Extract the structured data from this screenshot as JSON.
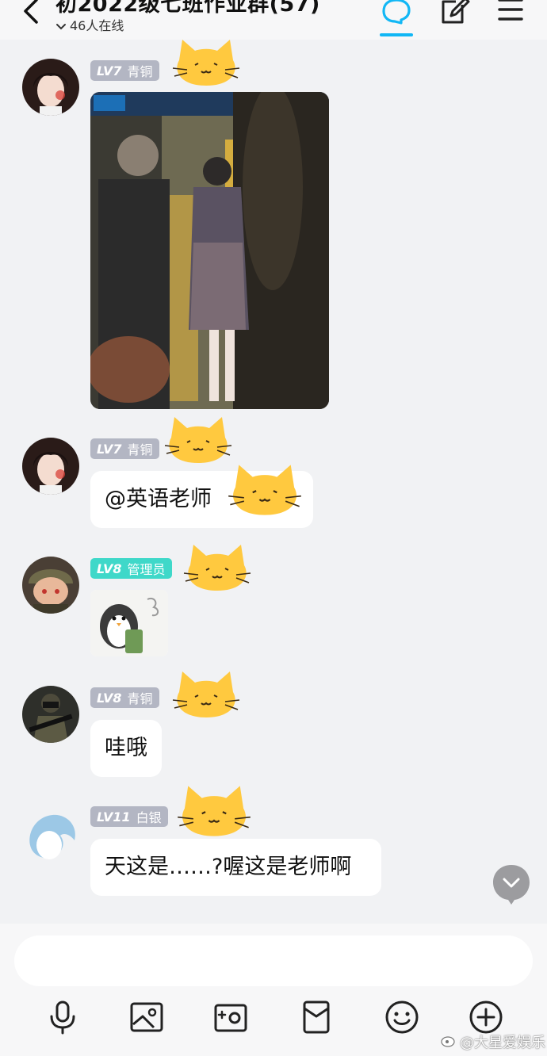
{
  "header": {
    "title": "初2022级七班作业群(57)",
    "online": "46人在线",
    "icons": [
      "back-arrow-icon",
      "chat-bubble-icon",
      "edit-icon",
      "menu-icon"
    ],
    "accent_color": "#12b7f5"
  },
  "messages": [
    {
      "level": "LV7",
      "rank": "青铜",
      "content_type": "photo"
    },
    {
      "level": "LV7",
      "rank": "青铜",
      "text": "@英语老师"
    },
    {
      "level": "LV8",
      "rank": "管理员",
      "content_type": "sticker"
    },
    {
      "level": "LV8",
      "rank": "青铜",
      "text": "哇哦"
    },
    {
      "level": "LV11",
      "rank": "白银",
      "text": "天这是……?喔这是老师啊"
    }
  ],
  "colors": {
    "background": "#f1f2f4",
    "bubble": "#ffffff",
    "badge_default": "#b3b6c3",
    "badge_admin": "#3fd8c9",
    "cat_sticker": "#ffc93f"
  },
  "toolbar": {
    "icons": [
      "microphone-icon",
      "image-icon",
      "camera-icon",
      "red-packet-icon",
      "emoji-icon",
      "plus-icon"
    ]
  },
  "watermark": "@大星爱娱乐"
}
